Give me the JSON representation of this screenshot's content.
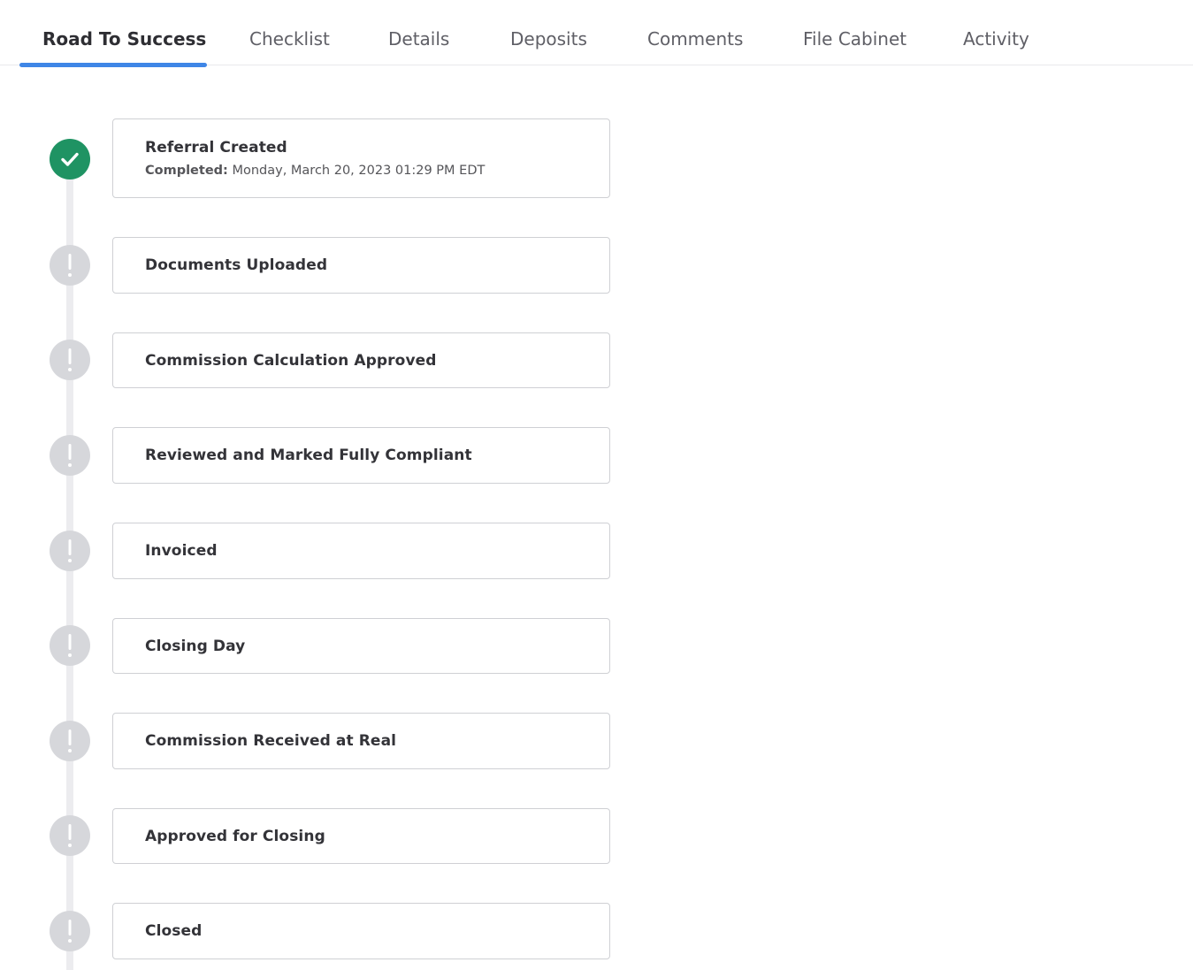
{
  "tabs": [
    {
      "label": "Road To Success",
      "active": true
    },
    {
      "label": "Checklist",
      "active": false
    },
    {
      "label": "Details",
      "active": false
    },
    {
      "label": "Deposits",
      "active": false
    },
    {
      "label": "Comments",
      "active": false
    },
    {
      "label": "File Cabinet",
      "active": false
    },
    {
      "label": "Activity",
      "active": false
    }
  ],
  "steps": [
    {
      "title": "Referral Created",
      "status": "completed",
      "icon": "check-circle-icon",
      "completed_label": "Completed:",
      "completed_value": "Monday, March 20, 2023 01:29 PM EDT"
    },
    {
      "title": "Documents Uploaded",
      "status": "pending",
      "icon": "exclamation-circle-icon"
    },
    {
      "title": "Commission Calculation Approved",
      "status": "pending",
      "icon": "exclamation-circle-icon"
    },
    {
      "title": "Reviewed and Marked Fully Compliant",
      "status": "pending",
      "icon": "exclamation-circle-icon"
    },
    {
      "title": "Invoiced",
      "status": "pending",
      "icon": "exclamation-circle-icon"
    },
    {
      "title": "Closing Day",
      "status": "pending",
      "icon": "exclamation-circle-icon"
    },
    {
      "title": "Commission Received at Real",
      "status": "pending",
      "icon": "exclamation-circle-icon"
    },
    {
      "title": "Approved for Closing",
      "status": "pending",
      "icon": "exclamation-circle-icon"
    },
    {
      "title": "Closed",
      "status": "pending",
      "icon": "exclamation-circle-icon"
    }
  ],
  "colors": {
    "accent": "#3f86e6",
    "completed": "#1f9363",
    "pending": "#d6d7db"
  }
}
